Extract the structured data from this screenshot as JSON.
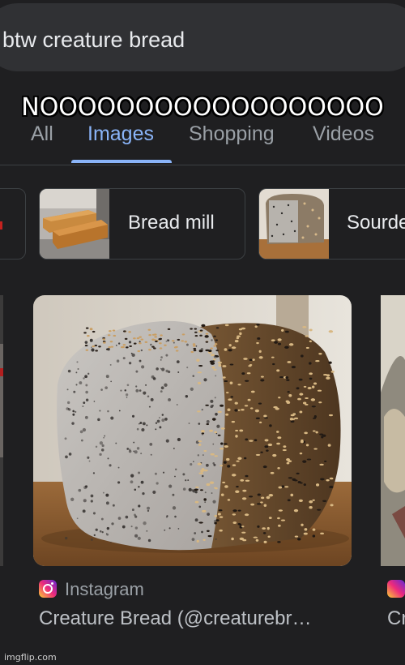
{
  "search": {
    "query": "btw creature bread"
  },
  "meme_caption": "NOOOOOOOOOOOOOOOOOO",
  "tabs": [
    {
      "label": "All",
      "active": false
    },
    {
      "label": "Images",
      "active": true
    },
    {
      "label": "Shopping",
      "active": false
    },
    {
      "label": "Videos",
      "active": false
    }
  ],
  "related_chips": [
    {
      "label": "Bread mill"
    },
    {
      "label": "Sourde"
    }
  ],
  "result": {
    "source": "Instagram",
    "title": "Creature Bread (@creaturebr…",
    "side_title": "Cr"
  },
  "watermark": "imgflip.com",
  "colors": {
    "background": "#1f1f21",
    "accent": "#8ab4f8",
    "search_bar": "#303134"
  }
}
